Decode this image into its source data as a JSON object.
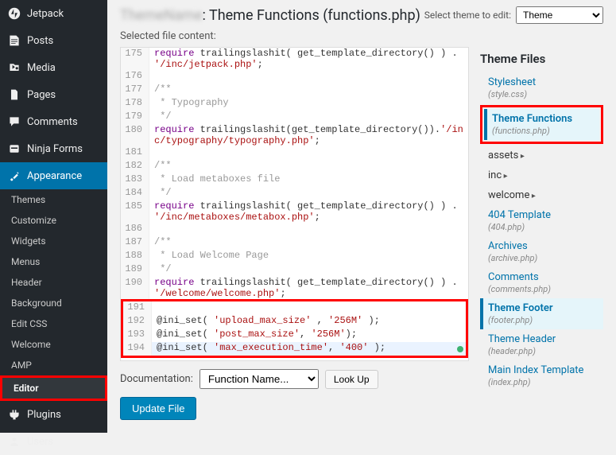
{
  "sidebar": {
    "main": [
      {
        "icon": "jetpack",
        "label": "Jetpack"
      },
      {
        "icon": "posts",
        "label": "Posts"
      },
      {
        "icon": "media",
        "label": "Media"
      },
      {
        "icon": "pages",
        "label": "Pages"
      },
      {
        "icon": "comments",
        "label": "Comments"
      },
      {
        "icon": "ninja",
        "label": "Ninja Forms"
      }
    ],
    "appearance": {
      "label": "Appearance"
    },
    "sub": [
      "Themes",
      "Customize",
      "Widgets",
      "Menus",
      "Header",
      "Background",
      "Edit CSS",
      "Welcome",
      "AMP",
      "Editor"
    ],
    "bottom": [
      {
        "icon": "plugins",
        "label": "Plugins"
      },
      {
        "icon": "users",
        "label": "Users"
      }
    ]
  },
  "header": {
    "title_prefix": "",
    "title": ": Theme Functions (functions.php)",
    "select_label": "Select theme to edit:",
    "select_placeholder": ""
  },
  "selected_label": "Selected file content:",
  "doc": {
    "label": "Documentation:",
    "select": "Function Name...",
    "lookup": "Look Up"
  },
  "update_label": "Update File",
  "files": {
    "title": "Theme Files",
    "items": [
      {
        "name": "Stylesheet",
        "sub": "(style.css)"
      },
      {
        "name": "Theme Functions",
        "sub": "(functions.php)",
        "active": true,
        "highlight": true
      },
      {
        "name": "assets",
        "folder": true
      },
      {
        "name": "inc",
        "folder": true
      },
      {
        "name": "welcome",
        "folder": true
      },
      {
        "name": "404 Template",
        "sub": "(404.php)"
      },
      {
        "name": "Archives",
        "sub": "(archive.php)"
      },
      {
        "name": "Comments",
        "sub": "(comments.php)"
      },
      {
        "name": "Theme Footer",
        "sub": "(footer.php)",
        "active": true
      },
      {
        "name": "Theme Header",
        "sub": "(header.php)"
      },
      {
        "name": "Main Index Template",
        "sub": "(index.php)"
      }
    ]
  },
  "code": [
    {
      "n": 175,
      "seg": [
        [
          "kw",
          "require"
        ],
        [
          "fn",
          " trailingslashit( get_template_directory() ) . "
        ],
        [
          "str",
          "'/inc/jetpack.php'"
        ],
        [
          "fn",
          ";"
        ]
      ]
    },
    {
      "n": 176,
      "seg": []
    },
    {
      "n": 177,
      "seg": [
        [
          "cm",
          "/**"
        ]
      ]
    },
    {
      "n": 178,
      "seg": [
        [
          "cm",
          " * Typography"
        ]
      ]
    },
    {
      "n": 179,
      "seg": [
        [
          "cm",
          " */"
        ]
      ]
    },
    {
      "n": 180,
      "seg": [
        [
          "kw",
          "require"
        ],
        [
          "fn",
          " trailingslashit(get_template_directory())."
        ],
        [
          "str",
          "'/inc/typography/typography.php'"
        ],
        [
          "fn",
          ";"
        ]
      ]
    },
    {
      "n": 181,
      "seg": []
    },
    {
      "n": 182,
      "seg": [
        [
          "cm",
          "/**"
        ]
      ]
    },
    {
      "n": 183,
      "seg": [
        [
          "cm",
          " * Load metaboxes file"
        ]
      ]
    },
    {
      "n": 184,
      "seg": [
        [
          "cm",
          " */"
        ]
      ]
    },
    {
      "n": 185,
      "seg": [
        [
          "kw",
          "require"
        ],
        [
          "fn",
          " trailingslashit( get_template_directory() ) . "
        ],
        [
          "str",
          "'/inc/metaboxes/metabox.php'"
        ],
        [
          "fn",
          ";"
        ]
      ]
    },
    {
      "n": 186,
      "seg": []
    },
    {
      "n": 187,
      "seg": [
        [
          "cm",
          "/**"
        ]
      ]
    },
    {
      "n": 188,
      "seg": [
        [
          "cm",
          " * Load Welcome Page"
        ]
      ]
    },
    {
      "n": 189,
      "seg": [
        [
          "cm",
          " */"
        ]
      ]
    },
    {
      "n": 190,
      "seg": [
        [
          "kw",
          "require"
        ],
        [
          "fn",
          " trailingslashit( get_template_directory() ) . "
        ],
        [
          "str",
          "'/welcome/welcome.php'"
        ],
        [
          "fn",
          ";"
        ]
      ]
    },
    {
      "n": 191,
      "seg": [],
      "hl_start": true
    },
    {
      "n": 192,
      "seg": [
        [
          "fn",
          "@ini_set( "
        ],
        [
          "str",
          "'upload_max_size'"
        ],
        [
          "fn",
          " , "
        ],
        [
          "str",
          "'256M'"
        ],
        [
          "fn",
          " );"
        ]
      ]
    },
    {
      "n": 193,
      "seg": [
        [
          "fn",
          "@ini_set( "
        ],
        [
          "str",
          "'post_max_size'"
        ],
        [
          "fn",
          ", "
        ],
        [
          "str",
          "'256M'"
        ],
        [
          "fn",
          ");"
        ]
      ]
    },
    {
      "n": 194,
      "seg": [
        [
          "fn",
          "@ini_set( "
        ],
        [
          "str",
          "'max_execution_time'"
        ],
        [
          "fn",
          ", "
        ],
        [
          "str",
          "'400'"
        ],
        [
          "fn",
          " );"
        ]
      ],
      "cur": true,
      "hl_end": true
    }
  ]
}
